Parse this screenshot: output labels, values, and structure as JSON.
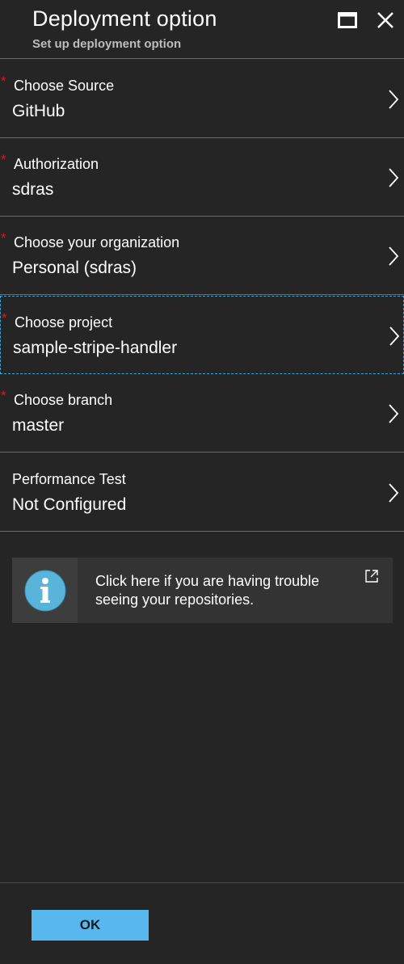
{
  "header": {
    "title": "Deployment option",
    "subtitle": "Set up deployment option"
  },
  "rows": [
    {
      "required": true,
      "label": "Choose Source",
      "value": "GitHub"
    },
    {
      "required": true,
      "label": "Authorization",
      "value": "sdras"
    },
    {
      "required": true,
      "label": "Choose your organization",
      "value": "Personal (sdras)"
    },
    {
      "required": true,
      "label": "Choose project",
      "value": "sample-stripe-handler",
      "focused": true
    },
    {
      "required": true,
      "label": "Choose branch",
      "value": "master"
    },
    {
      "required": false,
      "label": "Performance Test",
      "value": "Not Configured"
    }
  ],
  "required_marker": "*",
  "info": {
    "text": "Click here if you are having trouble seeing your repositories.",
    "icon": "info-icon",
    "link_icon": "external-link-icon"
  },
  "footer": {
    "ok_label": "OK"
  },
  "colors": {
    "background": "#252525",
    "accent": "#57b8f0",
    "required": "#e81123",
    "focus_outline": "#35a8d8"
  }
}
